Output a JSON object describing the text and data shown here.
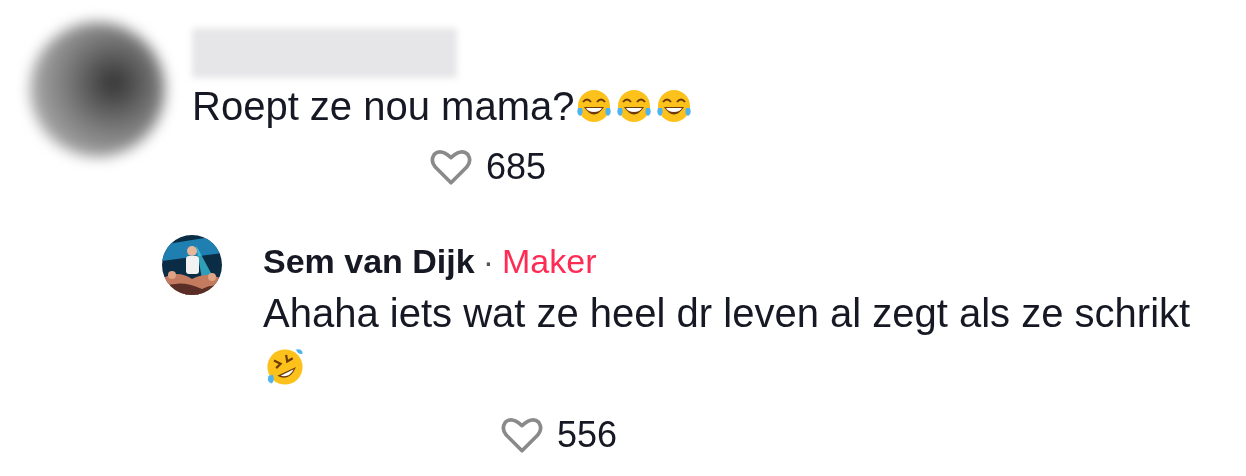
{
  "comments": [
    {
      "author": {
        "redacted": true
      },
      "avatar": {
        "kind": "blurred"
      },
      "text": "Roept ze nou mama?",
      "emojis": [
        {
          "kind": "tears-of-joy"
        },
        {
          "kind": "tears-of-joy"
        },
        {
          "kind": "tears-of-joy"
        }
      ],
      "likes": "685",
      "liked": false,
      "replies": [
        {
          "author": {
            "redacted": false,
            "name": "Sem van Dijk",
            "separator": "·",
            "badge": "Maker"
          },
          "text": "Ahaha iets wat ze heel dr leven al zegt als ze schrikt",
          "emojis": [
            {
              "kind": "rolling-laughing"
            }
          ],
          "likes": "556",
          "liked": false
        }
      ]
    }
  ]
}
